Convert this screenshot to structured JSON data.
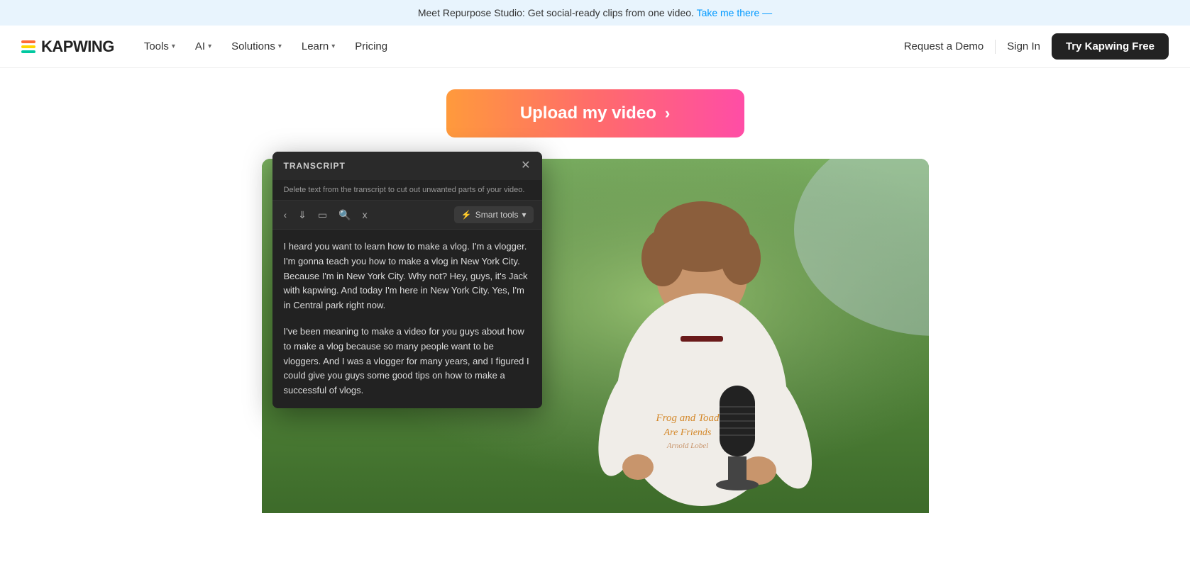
{
  "announcement": {
    "text": "Meet Repurpose Studio: Get social-ready clips from one video.",
    "link_text": "Take me there —",
    "link_href": "#"
  },
  "navbar": {
    "logo_text": "KAPWING",
    "nav_items": [
      {
        "label": "Tools",
        "has_dropdown": true
      },
      {
        "label": "AI",
        "has_dropdown": true
      },
      {
        "label": "Solutions",
        "has_dropdown": true
      },
      {
        "label": "Learn",
        "has_dropdown": true
      },
      {
        "label": "Pricing",
        "has_dropdown": false
      }
    ],
    "request_demo": "Request a Demo",
    "sign_in": "Sign In",
    "try_free": "Try Kapwing Free"
  },
  "upload_button": {
    "label": "Upload my video",
    "arrow": "›"
  },
  "transcript": {
    "title": "TRANSCRIPT",
    "subtitle": "Delete text from the transcript to cut out unwanted parts of your video.",
    "smart_tools": "Smart tools",
    "paragraph1": "I heard you want to learn how to make a vlog. I'm a vlogger. I'm gonna teach you how to make a vlog in New York City. Because I'm in New York City. Why not? Hey, guys, it's Jack with kapwing. And today I'm here in New York City. Yes, I'm in Central park right now.",
    "paragraph2": "I've been meaning to make a video for you guys about how to make a vlog because so many people want to be vloggers. And I was a vlogger for many years, and I figured I could give you guys some good tips on how to make a successful of vlogs."
  },
  "video": {
    "shirt_line1": "Frog and Toad",
    "shirt_line2": "Are Friends",
    "shirt_line3": "Arnold Lobel"
  }
}
